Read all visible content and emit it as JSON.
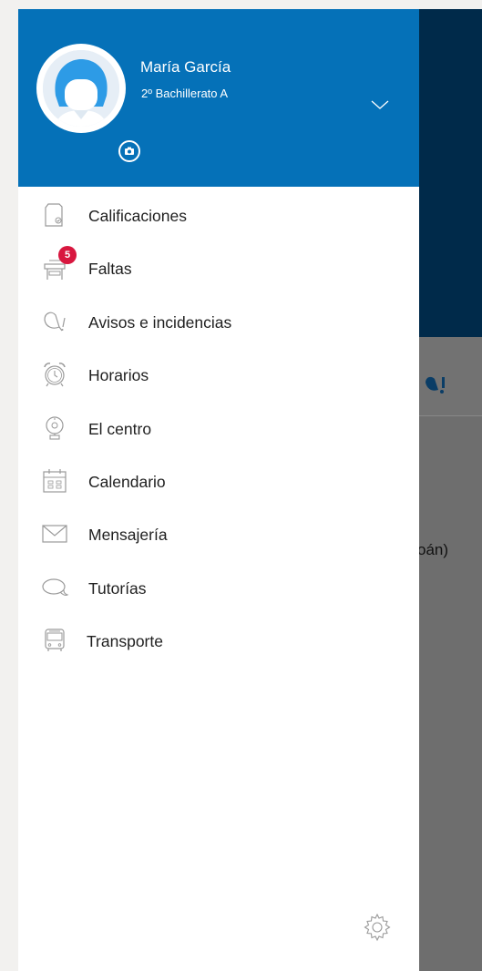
{
  "user": {
    "name": "María García",
    "class": "2º Bachillerato A"
  },
  "menu": {
    "items": [
      {
        "label": "Calificaciones",
        "icon": "document-check-icon"
      },
      {
        "label": "Faltas",
        "icon": "school-desk-icon",
        "badge": "5"
      },
      {
        "label": "Avisos e incidencias",
        "icon": "notice-icon"
      },
      {
        "label": "Horarios",
        "icon": "alarm-clock-icon"
      },
      {
        "label": "El centro",
        "icon": "school-bell-icon"
      },
      {
        "label": "Calendario",
        "icon": "calendar-icon"
      },
      {
        "label": "Mensajería",
        "icon": "envelope-icon"
      },
      {
        "label": "Tutorías",
        "icon": "speech-bubble-icon"
      },
      {
        "label": "Transporte",
        "icon": "bus-icon"
      }
    ]
  },
  "background": {
    "partial_text": "oán)"
  },
  "colors": {
    "header": "#0571b8",
    "badge": "#d8173f",
    "background_top": "#002a4a"
  }
}
